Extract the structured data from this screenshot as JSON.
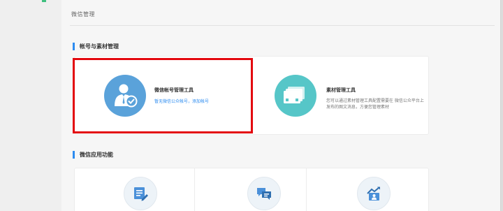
{
  "header": {
    "title": "微信管理"
  },
  "sections": [
    {
      "title": "帐号与素材管理",
      "tools": [
        {
          "name": "微信帐号管理工具",
          "link_text": "暂无微信公众帐号，添加帐号",
          "icon": "user-check-icon"
        },
        {
          "name": "素材管理工具",
          "description": "您可以通过素材管理工具配置需要在 微信公众平台上发布的图文消息，方便您管理素材",
          "icon": "media-library-icon"
        }
      ]
    },
    {
      "title": "微信应用功能",
      "apps": [
        {
          "icon": "form-edit-icon"
        },
        {
          "icon": "chat-bubbles-icon"
        },
        {
          "icon": "user-growth-icon"
        }
      ]
    }
  ],
  "colors": {
    "accent": "#2d8cf0",
    "highlight": "#e3080f",
    "user_tool": "#5aa2da",
    "media_tool": "#56c6c8"
  }
}
